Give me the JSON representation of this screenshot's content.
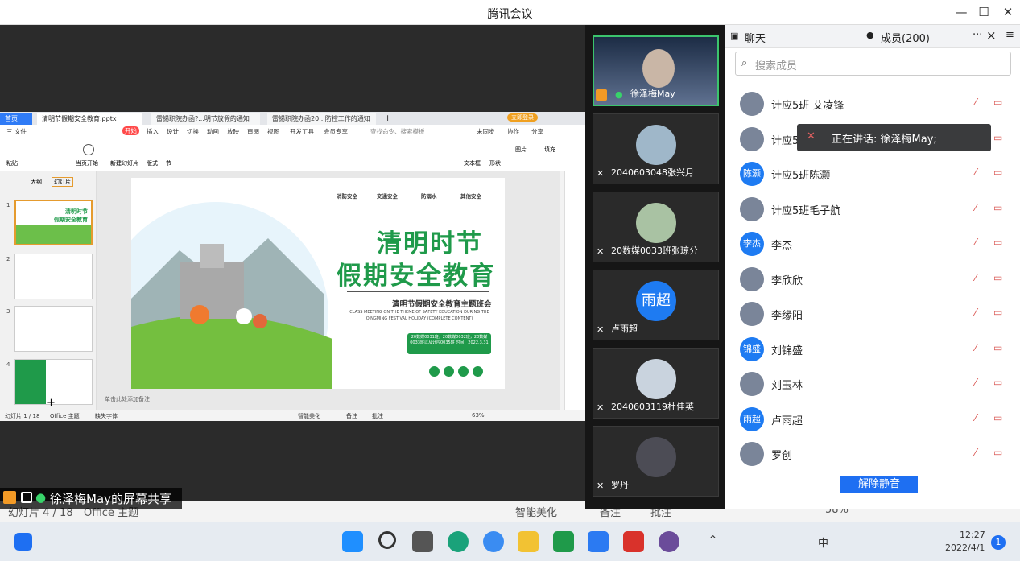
{
  "window": {
    "title": "腾讯会议"
  },
  "ppt": {
    "tabs": [
      "首页",
      "清明节假期安全教育.pptx",
      "雷锡职院办函?...明节放假的通知",
      "雷锡职院办函20...防控工作的通知"
    ],
    "tab_extra": "+",
    "vip_label": "立即登录",
    "menu": [
      "三 文件",
      "开始",
      "插入",
      "设计",
      "切换",
      "动画",
      "放映",
      "审阅",
      "视图",
      "开发工具",
      "会员专享",
      "查找命令、搜索模板",
      "未同步",
      "协作",
      "分享"
    ],
    "tool_labels": [
      "粘贴",
      "当页开始",
      "新建幻灯片",
      "版式",
      "节",
      "文本框",
      "形状",
      "图片",
      "填充"
    ],
    "thumb_tabs": [
      "大纲",
      "幻灯片"
    ],
    "thumb_numbers": [
      "1",
      "2",
      "3",
      "4"
    ],
    "thumb1_title": "清明时节\n假期安全教育",
    "add_slide": "+",
    "notes_placeholder": "单击此处添加备注",
    "slide": {
      "nav": [
        "消防安全",
        "交通安全",
        "防溺水",
        "其他安全"
      ],
      "title1": "清明时节",
      "title2": "假期安全教育",
      "subtitle": "清明节假期安全教育主题班会",
      "english": "CLASS MEETING ON THE THEME OF SAFETY EDUCATION DURING THE QINGMING FESTIVAL HOLIDAY (COMPLETE CONTENT)",
      "info": "20数媒0031班，20数媒0032班，20数媒0033班以及计应0035班  时间：2022.3.31"
    },
    "status": {
      "slide_pos": "幻灯片 1 / 18",
      "theme": "Office 主题",
      "font_missing": "缺失字体",
      "smart": "智能美化",
      "notes": "备注",
      "comment": "批注",
      "zoom": "63%"
    }
  },
  "share_label": "徐泽梅May的屏幕共享",
  "ghost_status": {
    "slide_pos": "幻灯片 4 / 18",
    "theme": "Office 主题",
    "smart": "智能美化",
    "notes": "备注",
    "comment": "批注",
    "zoom": "58%"
  },
  "videos": [
    {
      "name": "徐泽梅May",
      "avatar": ""
    },
    {
      "name": "2040603048张兴月",
      "avatar": ""
    },
    {
      "name": "20数媒0033班张琼分",
      "avatar": ""
    },
    {
      "name": "卢雨超",
      "avatar": "雨超"
    },
    {
      "name": "2040603119杜佳英",
      "avatar": ""
    },
    {
      "name": "罗丹",
      "avatar": ""
    }
  ],
  "panel": {
    "tab_chat": "聊天",
    "tab_members": "成员(200)",
    "more": "···",
    "close": "×",
    "search_placeholder": "搜索成员",
    "speaking": "正在讲话: 徐泽梅May;",
    "unmute": "解除静音",
    "members": [
      {
        "name": "计应5班  艾凌锋",
        "avatar": "",
        "blue": false
      },
      {
        "name": "计应5",
        "avatar": "",
        "blue": false
      },
      {
        "name": "计应5班陈灏",
        "avatar": "陈灏",
        "blue": true
      },
      {
        "name": "计应5班毛子航",
        "avatar": "",
        "blue": false
      },
      {
        "name": "李杰",
        "avatar": "李杰",
        "blue": true
      },
      {
        "name": "李欣欣",
        "avatar": "",
        "blue": false
      },
      {
        "name": "李缘阳",
        "avatar": "",
        "blue": false
      },
      {
        "name": "刘锦盛",
        "avatar": "锦盛",
        "blue": true
      },
      {
        "name": "刘玉林",
        "avatar": "",
        "blue": false
      },
      {
        "name": "卢雨超",
        "avatar": "雨超",
        "blue": true
      },
      {
        "name": "罗创",
        "avatar": "",
        "blue": false
      }
    ]
  },
  "taskbar": {
    "ime_lang": "中",
    "time": "12:27",
    "date": "2022/4/1",
    "notification_count": "1"
  }
}
